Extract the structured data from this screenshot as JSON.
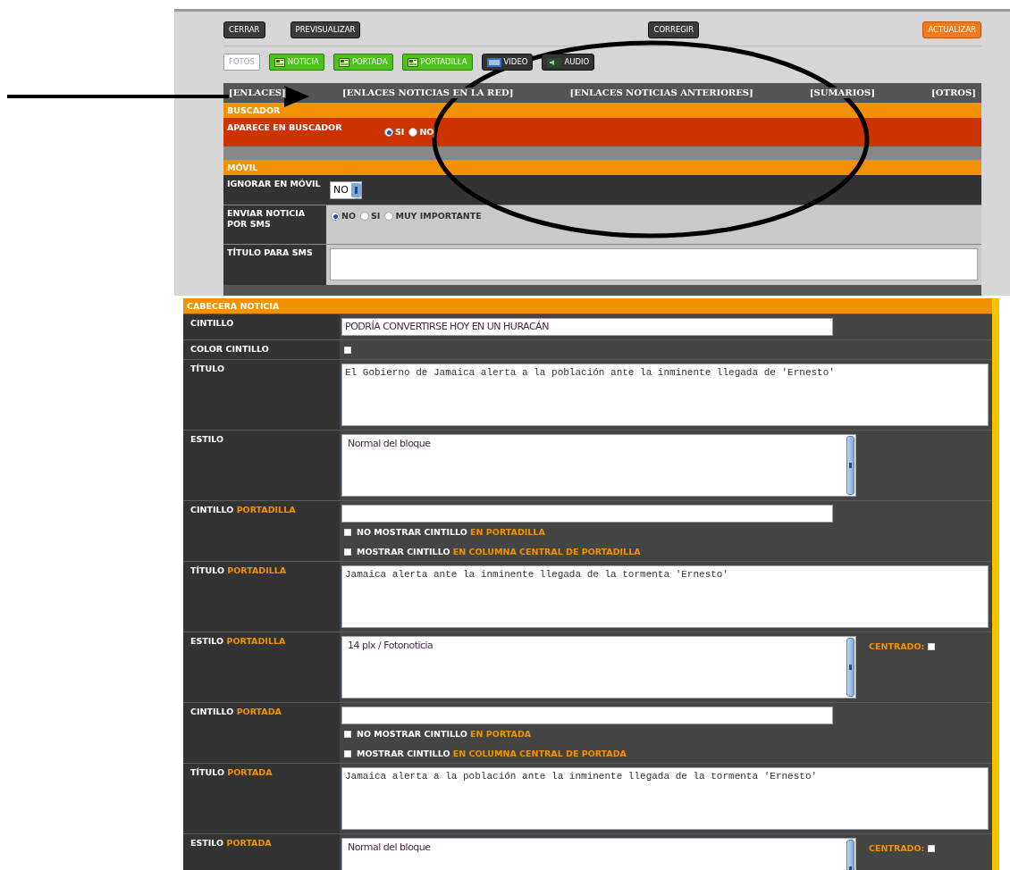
{
  "toolbar": [
    {
      "label": "CERRAR",
      "kind": "dark"
    },
    {
      "label": "PREVISUALIZAR",
      "kind": "dark"
    },
    {
      "label": "CORREGIR",
      "kind": "dark"
    },
    {
      "label": "ACTUALIZAR",
      "kind": "orange"
    }
  ],
  "media_buttons": [
    {
      "label": "FOTOS",
      "kind": "plain"
    },
    {
      "label": "NOTICIA",
      "kind": "green"
    },
    {
      "label": "PORTADA",
      "kind": "green"
    },
    {
      "label": "PORTADILLA",
      "kind": "green"
    },
    {
      "label": "VIDEO",
      "kind": "video"
    },
    {
      "label": "AUDIO",
      "kind": "audio"
    }
  ],
  "tabs": [
    "[ENLACES]",
    "[ENLACES NOTICIAS EN LA RED]",
    "[ENLACES NOTICIAS ANTERIORES]",
    "[SUMARIOS]",
    "[OTROS]"
  ],
  "buscador": {
    "title": "BUSCADOR",
    "label": "APARECE EN BUSCADOR",
    "options": [
      {
        "label": "SI",
        "selected": true
      },
      {
        "label": "NO",
        "selected": false
      }
    ]
  },
  "movil": {
    "title": "MÓVIL",
    "ignorar": {
      "label": "IGNORAR EN MÓVIL",
      "value": "NO"
    },
    "sms": {
      "label": "ENVIAR NOTICIA POR SMS",
      "options": [
        {
          "label": "NO",
          "selected": true
        },
        {
          "label": "SI",
          "selected": false
        },
        {
          "label": "MUY IMPORTANTE",
          "selected": false
        }
      ]
    },
    "titulo_sms": {
      "label": "TÍTULO PARA SMS"
    }
  },
  "cabecera": {
    "title": "CABECERA NOTICIA",
    "rows": [
      {
        "kind": "input",
        "label": "CINTILLO",
        "value": "PODRÍA CONVERTIRSE HOY EN UN HURACÁN"
      },
      {
        "kind": "checkbox",
        "label": "COLOR CINTILLO",
        "checked": false
      },
      {
        "kind": "textarea",
        "label": "TÍTULO",
        "value": "El Gobierno de Jamaica alerta a la población ante la inminente llegada de 'Ernesto'"
      },
      {
        "kind": "listbox",
        "label": "ESTILO",
        "value": "Normal del bloque"
      },
      {
        "kind": "cintillo",
        "label": "CINTILLO",
        "accent": "PORTADILLA",
        "options": [
          {
            "text": "NO MOSTRAR CINTILLO",
            "accent": "EN PORTADILLA",
            "checked": false
          },
          {
            "text": "MOSTRAR CINTILLO",
            "accent": "EN COLUMNA CENTRAL DE PORTADILLA",
            "checked": false
          }
        ]
      },
      {
        "kind": "textarea",
        "label": "TÍTULO",
        "accent": "PORTADILLA",
        "value": "Jamaica alerta ante la inminente llegada de la tormenta 'Ernesto'"
      },
      {
        "kind": "listbox",
        "label": "ESTILO",
        "accent": "PORTADILLA",
        "value": "14 plx / Fotonoticia",
        "centrado": {
          "label": "CENTRADO:",
          "checked": false
        }
      },
      {
        "kind": "cintillo",
        "label": "CINTILLO",
        "accent": "PORTADA",
        "options": [
          {
            "text": "NO MOSTRAR CINTILLO",
            "accent": "EN PORTADA",
            "checked": false
          },
          {
            "text": "MOSTRAR CINTILLO",
            "accent": "EN COLUMNA CENTRAL DE PORTADA",
            "checked": false
          }
        ]
      },
      {
        "kind": "textarea",
        "label": "TÍTULO",
        "accent": "PORTADA",
        "value": "Jamaica alerta a la población ante la inminente llegada de la tormenta 'Ernesto'"
      },
      {
        "kind": "listbox",
        "label": "ESTILO",
        "accent": "PORTADA",
        "value": "Normal del bloque",
        "centrado": {
          "label": "CENTRADO:",
          "checked": false
        }
      }
    ]
  }
}
